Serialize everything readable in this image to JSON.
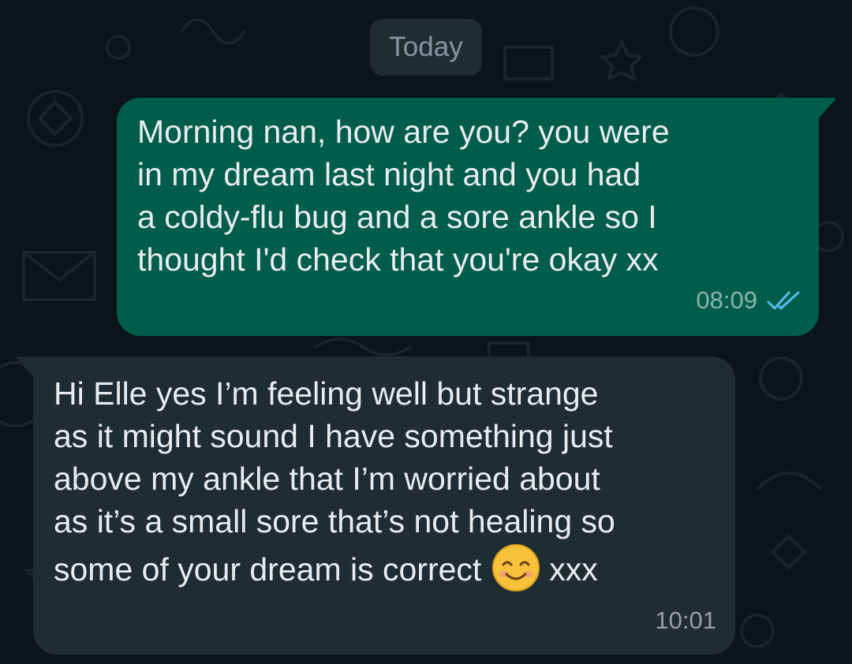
{
  "date_separator": "Today",
  "messages": [
    {
      "direction": "outgoing",
      "text": "Morning nan, how are you? you were\nin my dream last night and you had\na coldy-flu bug and a sore ankle so I\nthought I'd check that you're okay xx",
      "time": "08:09",
      "status_icon": "double-check-read-icon"
    },
    {
      "direction": "incoming",
      "text_before_emoji": "Hi Elle yes I’m feeling well but strange\nas it might sound I have something just\nabove my ankle that I’m worried about\nas it’s a small sore that’s not healing so\nsome of your dream is correct",
      "emoji": "smiling-face-with-smiling-eyes-emoji",
      "text_after_emoji": "xxx",
      "time": "10:01"
    }
  ],
  "colors": {
    "background": "#0b141a",
    "outgoing_bubble": "#005c4b",
    "incoming_bubble": "#1f2c34",
    "date_chip": "#1f2c34",
    "read_ticks": "#53bdeb"
  }
}
